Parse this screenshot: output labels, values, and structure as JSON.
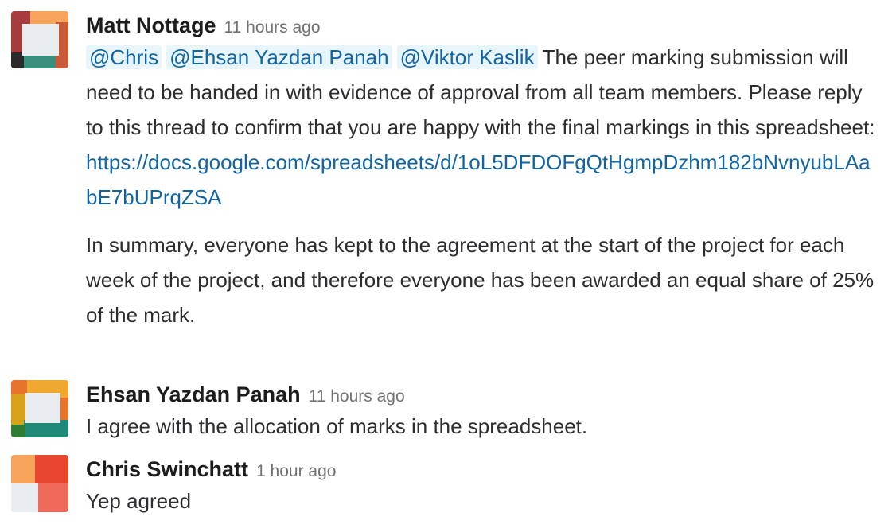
{
  "messages": [
    {
      "author": "Matt Nottage",
      "time": "11 hours ago",
      "avatar_colors": [
        "#a83b3b",
        "#f7a35c",
        "#e8ecef",
        "#3a8f7c",
        "#2a2a2a",
        "#c85a3a"
      ],
      "mentions": [
        "@Chris",
        "@Ehsan Yazdan Panah",
        "@Viktor Kaslik"
      ],
      "text1": "The peer marking submission will need to be handed in with evidence of approval from all team members. Please reply to this thread to confirm that you are happy with the final markings in this spreadsheet:",
      "link": "https://docs.google.com/spreadsheets/d/1oL5DFDOFgQtHgmpDzhm182bNvnyubLAabE7bUPrqZSA",
      "text2": "In summary, everyone has kept to the agreement at the start of the project for each week of the project, and therefore everyone has been awarded an equal share of 25% of the mark."
    },
    {
      "author": "Ehsan Yazdan Panah",
      "time": "11 hours ago",
      "avatar_colors": [
        "#e8732a",
        "#f0a830",
        "#e8ecef",
        "#1f8a78",
        "#2e7d32",
        "#d9a21b"
      ],
      "text": "I agree with the allocation of marks in the spreadsheet."
    },
    {
      "author": "Chris Swinchatt",
      "time": "1 hour ago",
      "avatar_colors": [
        "#f7a35c",
        "#e8462f",
        "#e8ecef",
        "#f06a5a"
      ],
      "text": "Yep agreed"
    }
  ]
}
